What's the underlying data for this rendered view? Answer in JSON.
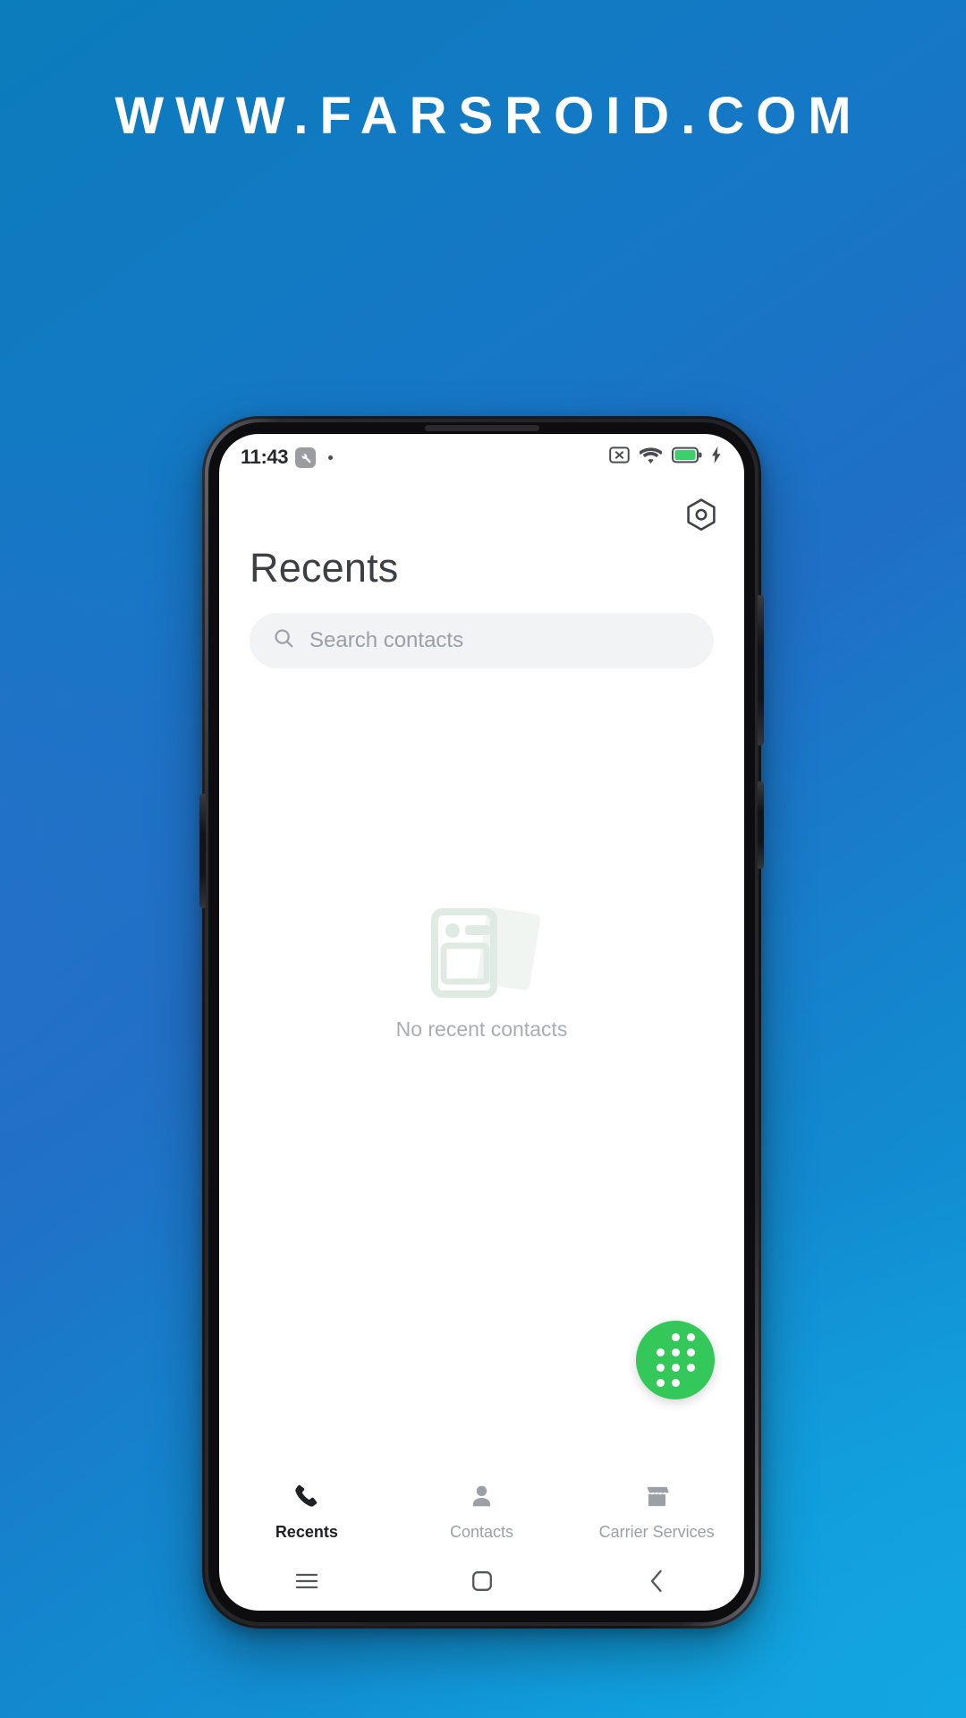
{
  "watermark": {
    "text": "WWW.FARSROID.COM"
  },
  "colors": {
    "background_top_left": "#0B7CBC",
    "background_mid_left": "#2470C8",
    "background_bottom_right": "#10A2DF",
    "fab_green": "#34C759",
    "status_battery_green": "#3CD06A",
    "screen_white": "#FFFFFF",
    "search_field": "#F1F3F4",
    "title_text": "#3D4043",
    "placeholder_text": "#9AA0A6",
    "empty_illustration": "#E3EDE7"
  },
  "statusbar": {
    "clock": "11:43",
    "wrench_icon": "wrench-icon",
    "notification_dot": "notification-dot",
    "sim_icon": "sim-card-disabled-icon",
    "wifi_icon": "wifi-icon",
    "battery_icon": "battery-charging-icon",
    "charging_icon": "charging-bolt-icon"
  },
  "header": {
    "settings_icon": "settings-gear-icon",
    "title": "Recents"
  },
  "search": {
    "icon": "search-icon",
    "placeholder": "Search contacts",
    "value": ""
  },
  "empty_state": {
    "illustration": "contact-cards-illustration",
    "message": "No recent contacts"
  },
  "fab": {
    "icon": "dialpad-icon",
    "label": "Dialpad"
  },
  "bottom_nav": {
    "items": [
      {
        "label": "Recents",
        "icon": "phone-handset-icon",
        "active": true
      },
      {
        "label": "Contacts",
        "icon": "person-icon",
        "active": false
      },
      {
        "label": "Carrier Services",
        "icon": "storefront-icon",
        "active": false
      }
    ]
  },
  "system_nav": {
    "items": [
      {
        "label": "Recent apps",
        "icon": "menu-hamburger-icon"
      },
      {
        "label": "Home",
        "icon": "square-home-icon"
      },
      {
        "label": "Back",
        "icon": "chevron-left-icon"
      }
    ]
  }
}
